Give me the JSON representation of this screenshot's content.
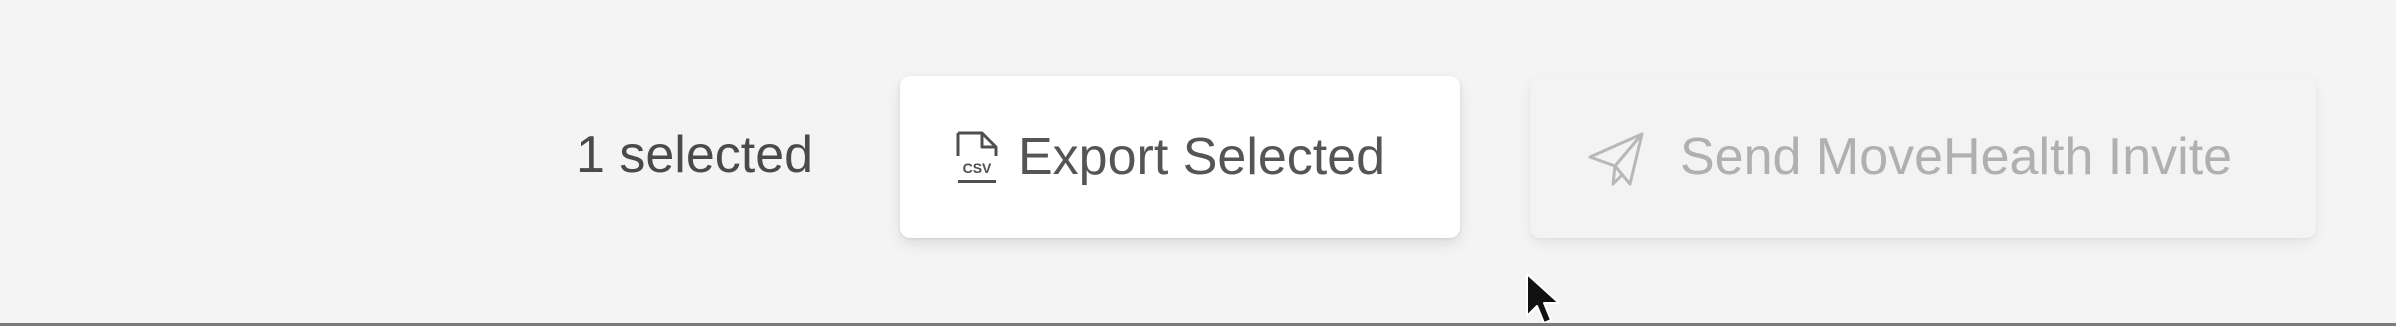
{
  "toolbar": {
    "selection_count": "1 selected",
    "export_button": {
      "label": "Export Selected",
      "icon": "csv-file-icon"
    },
    "invite_button": {
      "label": "Send MoveHealth Invite",
      "icon": "paper-plane-icon",
      "disabled": true
    }
  },
  "colors": {
    "background": "#f4f4f4",
    "export_button_bg": "#ffffff",
    "invite_button_bg": "#f3f3f3",
    "export_text": "#555555",
    "disabled_text": "#b0b0b0"
  }
}
